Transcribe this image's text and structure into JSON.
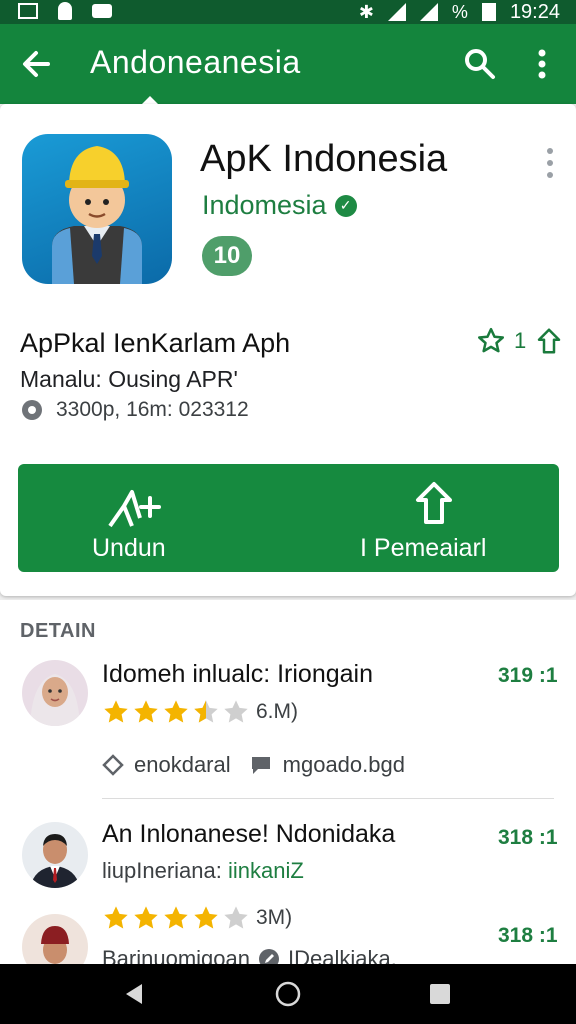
{
  "status": {
    "battery_percent": "%",
    "time": "19:24"
  },
  "toolbar": {
    "title": "Andoneanesia"
  },
  "app": {
    "title": "ApK Indonesia",
    "developer": "Indomesia",
    "rating_badge": "10",
    "subtitle": "ApPkal IenKarlam Aph",
    "meta_line": "Manalu: Ousing APR'",
    "info_line": "3300p, 16m: 023312",
    "wishlist_count": "1"
  },
  "actions": {
    "install_label": "Undun",
    "share_label": "I Pemeaiarl"
  },
  "details": {
    "heading": "DETAIN",
    "reviews": [
      {
        "name": "Idomeh inlualc: Iriongain",
        "count": "319 :1",
        "stars": 3.5,
        "total": "6.M)",
        "tag1": "enokdaral",
        "tag2": "mgoado.bgd"
      },
      {
        "name": "An Inlonanese! Ndonidaka",
        "count": "318 :1",
        "subline": "liupIneriana:",
        "subline_link": "iinkaniZ",
        "stars": 4,
        "total": "3M)"
      },
      {
        "count": "318 :1",
        "subline": "Barinuomigoan",
        "subline_tail": "IDealkiaka."
      }
    ]
  },
  "colors": {
    "status_bar": "#0f5b2e",
    "toolbar": "#14853d",
    "accent": "#168a3f",
    "star": "#f4b400"
  }
}
